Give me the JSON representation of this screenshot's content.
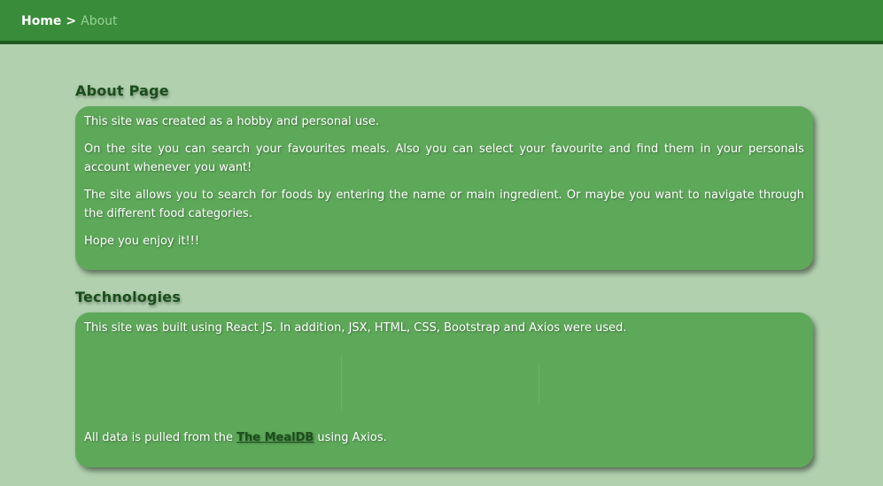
{
  "breadcrumb": {
    "home": "Home",
    "separator": ">",
    "current": "About"
  },
  "about": {
    "heading": "About Page",
    "paragraphs": [
      "This site was created as a hobby and personal use.",
      "On the site you can search your favourites meals. Also you can select your favourite and find them in your personals account whenever you want!",
      "The site allows you to search for foods by entering the name or main ingredient. Or maybe you want to navigate through the different food categories.",
      "Hope you enjoy it!!!"
    ]
  },
  "technologies": {
    "heading": "Technologies",
    "intro": "This site was built using React JS. In addition, JSX, HTML, CSS, Bootstrap and Axios were used.",
    "data_prefix": "All data is pulled from the ",
    "data_link": "The MealDB",
    "data_suffix": " using Axios."
  },
  "colors": {
    "topbar": "#398c39",
    "topbar_border": "#1e5a1e",
    "background": "#b0d0ae",
    "card": "#5ea85a",
    "heading": "#1b4e1b",
    "breadcrumb_current": "#98d098"
  }
}
